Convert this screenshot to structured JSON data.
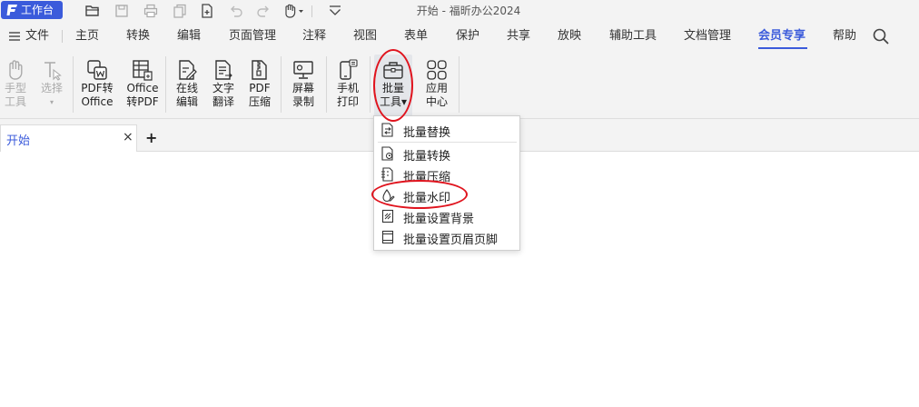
{
  "title_bar": {
    "workbench_label": "工作台",
    "app_title": "开始 - 福昕办公2024"
  },
  "menu": {
    "file_label": "文件",
    "items": [
      "主页",
      "转换",
      "编辑",
      "页面管理",
      "注释",
      "视图",
      "表单",
      "保护",
      "共享",
      "放映",
      "辅助工具",
      "文档管理",
      "会员专享",
      "帮助"
    ],
    "active": "会员专享"
  },
  "ribbon": {
    "hand_tool": {
      "line1": "手型",
      "line2": "工具"
    },
    "select": {
      "line1": "选择",
      "line2": "▾"
    },
    "pdf_to_office": {
      "line1": "PDF转",
      "line2": "Office"
    },
    "office_to_pdf": {
      "line1": "Office",
      "line2": "转PDF"
    },
    "online_edit": {
      "line1": "在线",
      "line2": "编辑"
    },
    "text_translate": {
      "line1": "文字",
      "line2": "翻译"
    },
    "pdf_compress": {
      "line1": "PDF",
      "line2": "压缩"
    },
    "screen_record": {
      "line1": "屏幕",
      "line2": "录制"
    },
    "phone_print": {
      "line1": "手机",
      "line2": "打印"
    },
    "batch_tools": {
      "line1": "批量",
      "line2": "工具▾"
    },
    "app_center": {
      "line1": "应用",
      "line2": "中心"
    }
  },
  "tabs": {
    "doc_tab_label": "开始",
    "close_glyph": "×",
    "new_tab_glyph": "+"
  },
  "batch_menu": {
    "items": [
      "批量替换",
      "批量转换",
      "批量压缩",
      "批量水印",
      "批量设置背景",
      "批量设置页眉页脚"
    ]
  },
  "colors": {
    "accent": "#3b5bdb",
    "annotation_red": "#e0141e"
  }
}
